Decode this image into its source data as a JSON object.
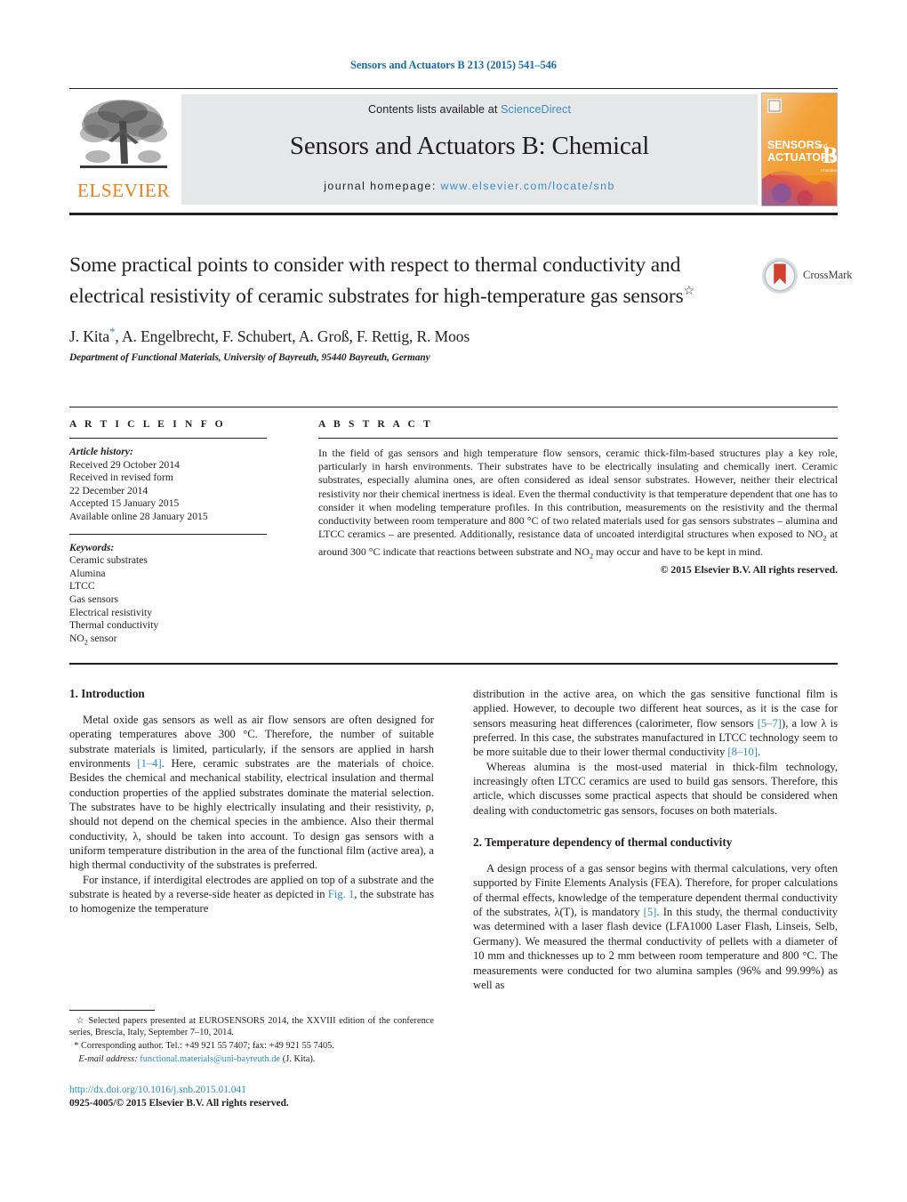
{
  "running_head": "Sensors and Actuators B 213 (2015) 541–546",
  "masthead": {
    "publisher_name": "ELSEVIER",
    "contents_prefix": "Contents lists available at ",
    "contents_link": "ScienceDirect",
    "journal_title": "Sensors and Actuators B: Chemical",
    "homepage_prefix": "journal homepage:",
    "homepage_url": "www.elsevier.com/locate/snb",
    "cover": {
      "line1": "SENSORS",
      "line1_small": "and",
      "line2": "ACTUATORS",
      "letter": "B",
      "letter_sub": "Chemical"
    }
  },
  "article": {
    "title": "Some practical points to consider with respect to thermal conductivity and electrical resistivity of ceramic substrates for high-temperature gas sensors",
    "title_marker": "☆",
    "authors": "J. Kita",
    "authors_rest": ", A. Engelbrecht, F. Schubert, A. Groß, F. Rettig, R. Moos",
    "corresponding_marker": "*",
    "affiliation": "Department of Functional Materials, University of Bayreuth, 95440 Bayreuth, Germany",
    "crossmark_label": "CrossMark"
  },
  "article_info": {
    "heading": "A R T I C L E  I N F O",
    "history_label": "Article history:",
    "history": [
      "Received 29 October 2014",
      "Received in revised form",
      "22 December 2014",
      "Accepted 15 January 2015",
      "Available online 28 January 2015"
    ],
    "keywords_label": "Keywords:",
    "keywords": [
      "Ceramic substrates",
      "Alumina",
      "LTCC",
      "Gas sensors",
      "Electrical resistivity",
      "Thermal conductivity"
    ],
    "keyword_no2": "NO",
    "keyword_no2_sub": "2",
    "keyword_no2_rest": " sensor"
  },
  "abstract": {
    "heading": "A B S T R A C T",
    "p1": "In the field of gas sensors and high temperature flow sensors, ceramic thick-film-based structures play a key role, particularly in harsh environments. Their substrates have to be electrically insulating and chemically inert. Ceramic substrates, especially alumina ones, are often considered as ideal sensor substrates. However, neither their electrical resistivity nor their chemical inertness is ideal. Even the thermal conductivity is that temperature dependent that one has to consider it when modeling temperature profiles. In this contribution, measurements on the resistivity and the thermal conductivity between room temperature and 800 °C of two related materials used for gas sensors substrates – alumina and LTCC ceramics – are presented. Additionally, resistance data of uncoated interdigital structures when exposed to NO",
    "p1_sub": "2",
    "p1_cont": " at around 300 °C indicate that reactions between substrate and NO",
    "p1_sub2": "2",
    "p1_end": " may occur and have to be kept in mind.",
    "copyright": "© 2015 Elsevier B.V. All rights reserved."
  },
  "sections": {
    "intro_heading": "1.  Introduction",
    "intro_p1_a": "Metal oxide gas sensors as well as air flow sensors are often designed for operating temperatures above 300 °C. Therefore, the number of suitable substrate materials is limited, particularly, if the sensors are applied in harsh environments ",
    "intro_p1_ref": "[1–4]",
    "intro_p1_b": ". Here, ceramic substrates are the materials of choice. Besides the chemical and mechanical stability, electrical insulation and thermal conduction properties of the applied substrates dominate the material selection. The substrates have to be highly electrically insulating and their resistivity, ρ, should not depend on the chemical species in the ambience. Also their thermal conductivity, λ, should be taken into account. To design gas sensors with a uniform temperature distribution in the area of the functional film (active area), a high thermal conductivity of the substrates is preferred.",
    "intro_p2_a": "For instance, if interdigital electrodes are applied on top of a substrate and the substrate is heated by a reverse-side heater as depicted in ",
    "intro_p2_ref": "Fig. 1",
    "intro_p2_b": ", the substrate has to homogenize the temperature",
    "right_p1_a": "distribution in the active area, on which the gas sensitive functional film is applied. However, to decouple two different heat sources, as it is the case for sensors measuring heat differences (calorimeter, flow sensors ",
    "right_p1_ref1": "[5–7]",
    "right_p1_b": "), a low λ is preferred. In this case, the substrates manufactured in LTCC technology seem to be more suitable due to their lower thermal conductivity ",
    "right_p1_ref2": "[8–10]",
    "right_p1_c": ".",
    "right_p2": "Whereas alumina is the most-used material in thick-film technology, increasingly often LTCC ceramics are used to build gas sensors. Therefore, this article, which discusses some practical aspects that should be considered when dealing with conductometric gas sensors, focuses on both materials.",
    "sec2_heading": "2.  Temperature dependency of thermal conductivity",
    "sec2_p1_a": "A design process of a gas sensor begins with thermal calculations, very often supported by Finite Elements Analysis (FEA). Therefore, for proper calculations of thermal effects, knowledge of the temperature dependent thermal conductivity of the substrates, λ(T), is mandatory ",
    "sec2_p1_ref": "[5]",
    "sec2_p1_b": ". In this study, the thermal conductivity was determined with a laser flash device (LFA1000 Laser Flash, Linseis, Selb, Germany). We measured the thermal conductivity of pellets with a diameter of 10 mm and thicknesses up to 2 mm between room temperature and 800 °C. The measurements were conducted for two alumina samples (96% and 99.99%) as well as"
  },
  "footnotes": {
    "star_marker": "☆",
    "star_text": " Selected papers presented at EUROSENSORS 2014, the XXVIII edition of the conference series, Brescia, Italy, September 7–10, 2014.",
    "corr_marker": "*",
    "corr_text": " Corresponding author. Tel.: +49 921 55 7407; fax: +49 921 55 7405.",
    "email_label": "E-mail address:",
    "email": "functional.materials@uni-bayreuth.de",
    "email_suffix": " (J. Kita)."
  },
  "doi_block": {
    "doi_url": "http://dx.doi.org/10.1016/j.snb.2015.01.041",
    "issn_line": "0925-4005/© 2015 Elsevier B.V. All rights reserved."
  },
  "colors": {
    "link_blue": "#2a8bc4",
    "elsevier_orange": "#f07d16",
    "band_grey": "#e6e7e8",
    "text": "#231f20"
  }
}
